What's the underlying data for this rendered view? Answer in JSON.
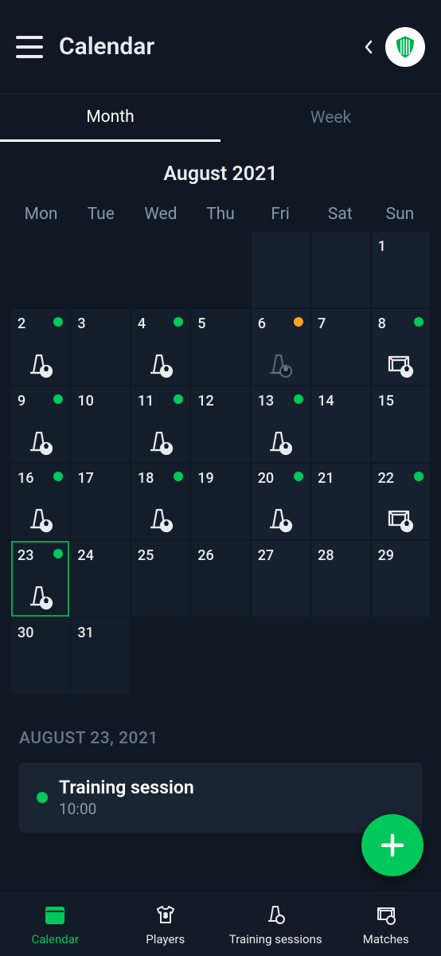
{
  "header": {
    "title": "Calendar"
  },
  "tabs": {
    "month": "Month",
    "week": "Week",
    "active": "month"
  },
  "month_label": "August 2021",
  "weekdays": [
    "Mon",
    "Tue",
    "Wed",
    "Thu",
    "Fri",
    "Sat",
    "Sun"
  ],
  "grid": [
    [
      {
        "empty": true
      },
      {
        "empty": true
      },
      {
        "empty": true
      },
      {
        "empty": true
      },
      {
        "empty": true,
        "shifted": true
      },
      {
        "empty": true,
        "shifted": true
      },
      {
        "day": 1,
        "shifted": true
      }
    ],
    [
      {
        "day": 2,
        "dot": "green",
        "icon": "training"
      },
      {
        "day": 3
      },
      {
        "day": 4,
        "dot": "green",
        "icon": "training"
      },
      {
        "day": 5
      },
      {
        "day": 6,
        "dot": "orange",
        "icon": "training",
        "icon_dim": true,
        "shifted": true
      },
      {
        "day": 7,
        "shifted": true
      },
      {
        "day": 8,
        "dot": "green",
        "icon": "match",
        "shifted": true
      }
    ],
    [
      {
        "day": 9,
        "dot": "green",
        "icon": "training"
      },
      {
        "day": 10
      },
      {
        "day": 11,
        "dot": "green",
        "icon": "training"
      },
      {
        "day": 12
      },
      {
        "day": 13,
        "dot": "green",
        "icon": "training",
        "shifted": true
      },
      {
        "day": 14,
        "shifted": true
      },
      {
        "day": 15,
        "shifted": true
      }
    ],
    [
      {
        "day": 16,
        "dot": "green",
        "icon": "training"
      },
      {
        "day": 17
      },
      {
        "day": 18,
        "dot": "green",
        "icon": "training"
      },
      {
        "day": 19
      },
      {
        "day": 20,
        "dot": "green",
        "icon": "training",
        "shifted": true
      },
      {
        "day": 21,
        "shifted": true
      },
      {
        "day": 22,
        "dot": "green",
        "icon": "match",
        "shifted": true
      }
    ],
    [
      {
        "day": 23,
        "dot": "green",
        "icon": "training",
        "selected": true
      },
      {
        "day": 24
      },
      {
        "day": 25
      },
      {
        "day": 26
      },
      {
        "day": 27,
        "shifted": true
      },
      {
        "day": 28,
        "shifted": true
      },
      {
        "day": 29,
        "shifted": true
      }
    ],
    [
      {
        "day": 30
      },
      {
        "day": 31
      },
      {
        "empty": true
      },
      {
        "empty": true
      },
      {
        "empty": true
      },
      {
        "empty": true
      },
      {
        "empty": true
      }
    ]
  ],
  "selected_day": {
    "heading": "AUGUST 23, 2021",
    "event": {
      "title": "Training session",
      "time": "10:00"
    }
  },
  "nav": {
    "calendar": "Calendar",
    "players": "Players",
    "training": "Training sessions",
    "matches": "Matches",
    "active": "calendar"
  }
}
